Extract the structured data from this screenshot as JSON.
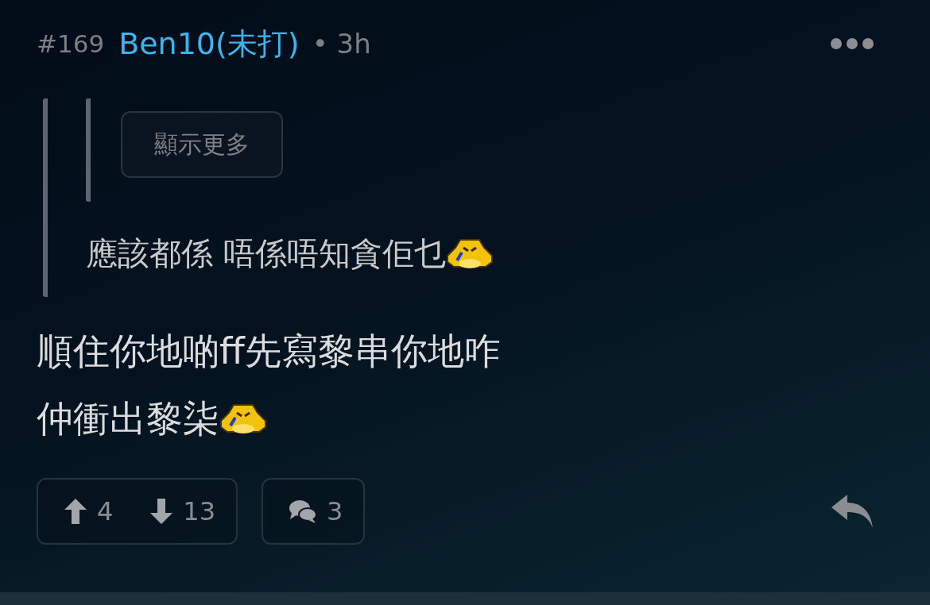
{
  "post": {
    "number": "#169",
    "author": "Ben10(未打)",
    "separator": "•",
    "time": "3h"
  },
  "quote": {
    "nested_quote": {
      "show_more": "顯示更多"
    },
    "text": "應該都係 唔係唔知貪佢乜",
    "emoji": true
  },
  "body": [
    {
      "text": "順住你地啲ff先寫黎串你地咋",
      "emoji": false
    },
    {
      "text": "仲衝出黎柒",
      "emoji": true
    }
  ],
  "actions": {
    "upvotes": "4",
    "downvotes": "13",
    "comments": "3"
  }
}
